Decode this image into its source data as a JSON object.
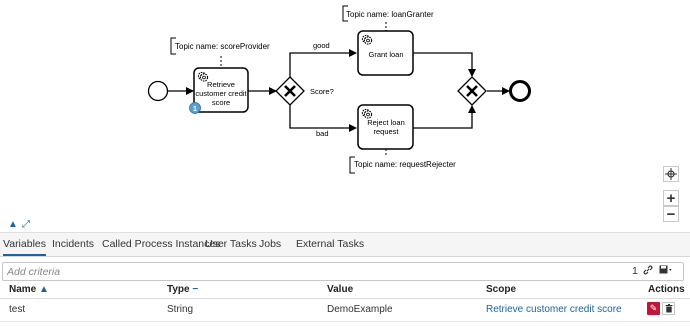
{
  "diagram": {
    "annotations": {
      "score_provider": "Topic name: scoreProvider",
      "loan_granter": "Topic name: loanGranter",
      "request_rejecter": "Topic name: requestRejecter"
    },
    "tasks": {
      "retrieve_score": [
        "Retrieve",
        "customer credit",
        "score"
      ],
      "grant_loan": [
        "Grant loan"
      ],
      "reject_loan": [
        "Reject loan",
        "request"
      ]
    },
    "gateway_label": "Score?",
    "flow_labels": {
      "good": "good",
      "bad": "bad"
    },
    "badge_count": "1",
    "colors": {
      "badge": "#5aa0d8",
      "stroke": "#000000"
    }
  },
  "tabs": [
    "Variables",
    "Incidents",
    "Called Process Instances",
    "User Tasks",
    "Jobs",
    "External Tasks"
  ],
  "active_tab": "Variables",
  "search": {
    "placeholder": "Add criteria",
    "count": "1"
  },
  "table": {
    "headers": {
      "name": "Name",
      "type": "Type",
      "value": "Value",
      "scope": "Scope",
      "actions": "Actions"
    },
    "rows": [
      {
        "name": "test",
        "type": "String",
        "value": "DemoExample",
        "scope": "Retrieve customer credit score"
      }
    ]
  },
  "colors": {
    "accent": "#1a63a8",
    "delete": "#c0163a"
  }
}
